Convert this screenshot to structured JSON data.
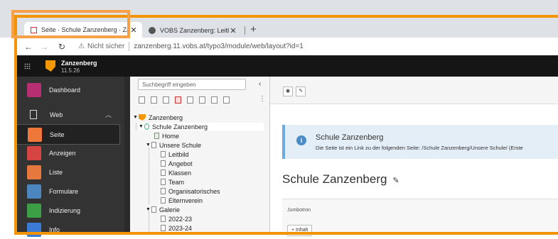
{
  "browser": {
    "tabs": [
      {
        "title": "Seite · Schule Zanzenberg · Zanz",
        "active": true
      },
      {
        "title": "VOBS Zanzenberg: Leitbild",
        "active": false
      }
    ],
    "new_tab": "+",
    "security_label": "Nicht sicher",
    "url": "zanzenberg.11.vobs.at/typo3/module/web/layout?id=1"
  },
  "topbar": {
    "site_name": "Zanzenberg",
    "version": "11.5.26"
  },
  "modules": {
    "dashboard": "Dashboard",
    "web": "Web",
    "items": [
      {
        "label": "Seite",
        "color": "#f0773a",
        "active": true
      },
      {
        "label": "Anzeigen",
        "color": "#d64541",
        "active": false
      },
      {
        "label": "Liste",
        "color": "#e5793d",
        "active": false
      },
      {
        "label": "Formulare",
        "color": "#4b86be",
        "active": false
      },
      {
        "label": "Indizierung",
        "color": "#3d9f45",
        "active": false
      },
      {
        "label": "Info",
        "color": "#3a7bd5",
        "active": false
      }
    ]
  },
  "tree": {
    "search_placeholder": "Suchbegriff eingeben",
    "nodes": [
      {
        "label": "Zanzenberg"
      },
      {
        "label": "Schule Zanzenberg"
      },
      {
        "label": "Home"
      },
      {
        "label": "Unsere Schule"
      },
      {
        "label": "Leitbild"
      },
      {
        "label": "Angebot"
      },
      {
        "label": "Klassen"
      },
      {
        "label": "Team"
      },
      {
        "label": "Organisatorisches"
      },
      {
        "label": "Elternverein"
      },
      {
        "label": "Galerie"
      },
      {
        "label": "2022-23"
      },
      {
        "label": "2023-24"
      }
    ]
  },
  "content": {
    "info_title": "Schule Zanzenberg",
    "info_text": "Die Seite ist ein Link zu der folgenden Seite: /Schule Zanzenberg/Unsere Schule/ (Erste",
    "page_title": "Schule Zanzenberg",
    "column_label": "Jumbotron",
    "add_button": "+ Inhalt"
  }
}
